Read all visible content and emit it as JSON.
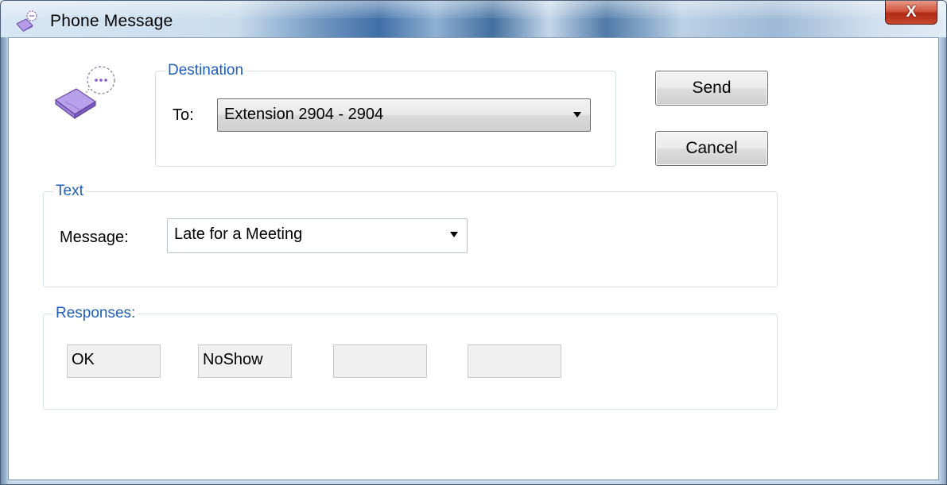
{
  "window": {
    "title": "Phone Message",
    "close_label": "X"
  },
  "destination": {
    "legend": "Destination",
    "to_label": "To:",
    "to_value": "Extension 2904 - 2904"
  },
  "buttons": {
    "send": "Send",
    "cancel": "Cancel"
  },
  "text_group": {
    "legend": "Text",
    "message_label": "Message:",
    "message_value": "Late for a Meeting"
  },
  "responses": {
    "legend": "Responses:",
    "items": [
      "OK",
      "NoShow",
      "",
      ""
    ]
  },
  "icons": {
    "title": "phone-message-icon",
    "main": "phone-message-icon"
  },
  "colors": {
    "group_legend": "#1d5fb8",
    "close_button": "#c8472f"
  }
}
